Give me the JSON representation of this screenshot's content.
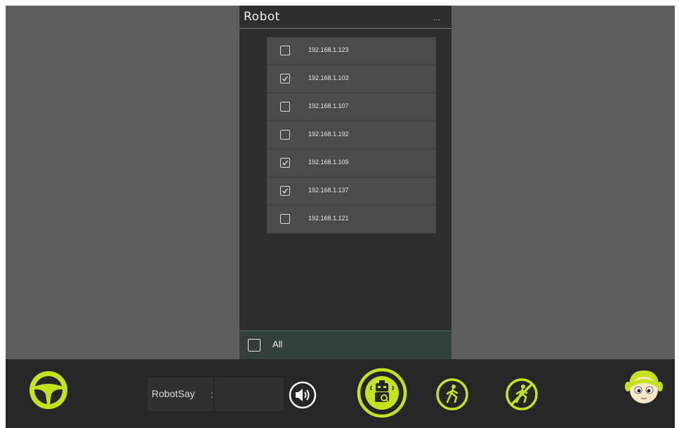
{
  "panel": {
    "title": "Robot",
    "menu": "...",
    "items": [
      {
        "ip": "192.168.1.123",
        "checked": false
      },
      {
        "ip": "192.168.1.103",
        "checked": true
      },
      {
        "ip": "192.168.1.107",
        "checked": false
      },
      {
        "ip": "192.168.1.192",
        "checked": false
      },
      {
        "ip": "192.168.1.109",
        "checked": true
      },
      {
        "ip": "192.168.1.137",
        "checked": true
      },
      {
        "ip": "192.168.1.121",
        "checked": false
      }
    ],
    "all_label": "All",
    "all_checked": false
  },
  "toolbar": {
    "robot_say_label": "RobotSay",
    "colon": ":",
    "robot_say_value": "",
    "icons": [
      "steering-wheel-icon",
      "speaker-icon",
      "robot-search-icon",
      "walk-icon",
      "no-walk-icon",
      "robot-face-icon"
    ]
  },
  "colors": {
    "accent": "#c5e31c",
    "background": "#5e5e5e",
    "panel": "#2c2d2d",
    "bottom_bar": "#262626"
  }
}
